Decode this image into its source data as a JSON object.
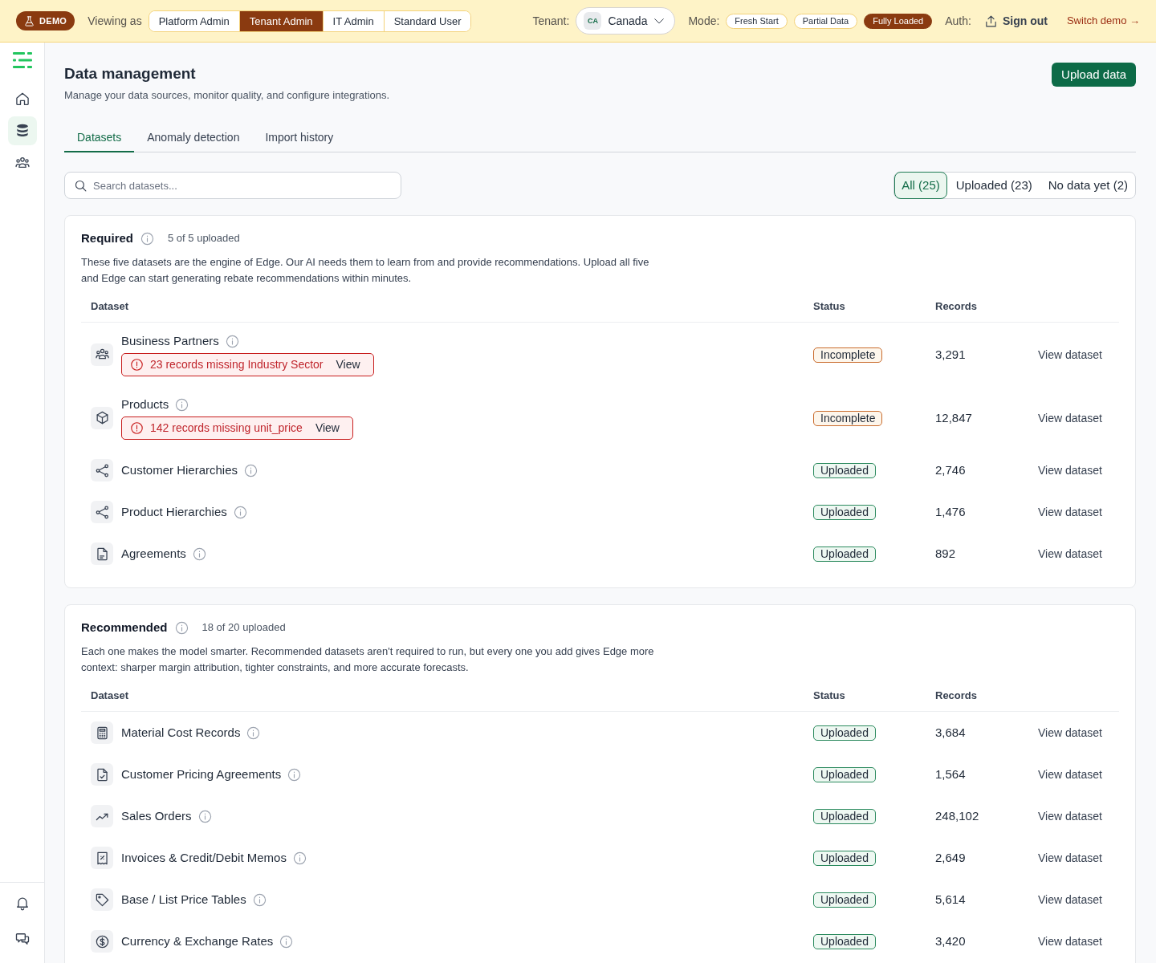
{
  "demo_bar": {
    "badge": "DEMO",
    "viewing_as_label": "Viewing as",
    "roles": [
      {
        "label": "Platform Admin",
        "selected": false
      },
      {
        "label": "Tenant Admin",
        "selected": true
      },
      {
        "label": "IT Admin",
        "selected": false
      },
      {
        "label": "Standard User",
        "selected": false
      }
    ],
    "tenant_label": "Tenant:",
    "tenant": {
      "code": "CA",
      "name": "Canada"
    },
    "mode_label": "Mode:",
    "modes": [
      {
        "label": "Fresh Start",
        "selected": false
      },
      {
        "label": "Partial Data",
        "selected": false
      },
      {
        "label": "Fully Loaded",
        "selected": true
      }
    ],
    "auth_label": "Auth:",
    "sign_out": "Sign out",
    "switch_demo": "Switch demo →"
  },
  "sidebar": {
    "items": [
      {
        "kind": "home",
        "selected": false
      },
      {
        "kind": "database",
        "selected": true
      },
      {
        "kind": "people",
        "selected": false
      }
    ],
    "bottom_items": [
      {
        "kind": "bell"
      },
      {
        "kind": "chat"
      }
    ]
  },
  "page": {
    "title": "Data management",
    "subtitle": "Manage your data sources, monitor quality, and configure integrations.",
    "upload_button": "Upload data"
  },
  "tabs": [
    {
      "label": "Datasets",
      "selected": true
    },
    {
      "label": "Anomaly detection",
      "selected": false
    },
    {
      "label": "Import history",
      "selected": false
    }
  ],
  "search": {
    "placeholder": "Search datasets..."
  },
  "filters": [
    {
      "label": "All (25)",
      "selected": true
    },
    {
      "label": "Uploaded (23)",
      "selected": false
    },
    {
      "label": "No data yet (2)",
      "selected": false
    }
  ],
  "sections": [
    {
      "title": "Required",
      "progress": "5 of 5 uploaded",
      "description": "These five datasets are the engine of Edge. Our AI needs them to learn from and provide recommendations. Upload all five and Edge can start generating rebate recommendations within minutes.",
      "columns": [
        "Dataset",
        "Status",
        "Records"
      ],
      "rows": [
        {
          "kind": "people",
          "name": "Business Partners",
          "alert": {
            "text": "23 records missing Industry Sector",
            "action": "View"
          },
          "status": {
            "kind": "incomplete",
            "label": "Incomplete"
          },
          "records": "3,291",
          "action": "View dataset"
        },
        {
          "kind": "cube",
          "name": "Products",
          "alert": {
            "text": "142 records missing unit_price",
            "action": "View"
          },
          "status": {
            "kind": "incomplete",
            "label": "Incomplete"
          },
          "records": "12,847",
          "action": "View dataset"
        },
        {
          "kind": "share",
          "name": "Customer Hierarchies",
          "status": {
            "kind": "uploaded",
            "label": "Uploaded"
          },
          "records": "2,746",
          "action": "View dataset"
        },
        {
          "kind": "share",
          "name": "Product Hierarchies",
          "status": {
            "kind": "uploaded",
            "label": "Uploaded"
          },
          "records": "1,476",
          "action": "View dataset"
        },
        {
          "kind": "document",
          "name": "Agreements",
          "status": {
            "kind": "uploaded",
            "label": "Uploaded"
          },
          "records": "892",
          "action": "View dataset"
        }
      ]
    },
    {
      "title": "Recommended",
      "progress": "18 of 20 uploaded",
      "description": "Each one makes the model smarter. Recommended datasets aren't required to run, but every one you add gives Edge more context: sharper margin attribution, tighter constraints, and more accurate forecasts.",
      "columns": [
        "Dataset",
        "Status",
        "Records"
      ],
      "rows": [
        {
          "kind": "calculator",
          "name": "Material Cost Records",
          "status": {
            "kind": "uploaded",
            "label": "Uploaded"
          },
          "records": "3,684",
          "action": "View dataset"
        },
        {
          "kind": "document-check",
          "name": "Customer Pricing Agreements",
          "status": {
            "kind": "uploaded",
            "label": "Uploaded"
          },
          "records": "1,564",
          "action": "View dataset"
        },
        {
          "kind": "trend",
          "name": "Sales Orders",
          "status": {
            "kind": "uploaded",
            "label": "Uploaded"
          },
          "records": "248,102",
          "action": "View dataset"
        },
        {
          "kind": "receipt",
          "name": "Invoices & Credit/Debit Memos",
          "status": {
            "kind": "uploaded",
            "label": "Uploaded"
          },
          "records": "2,649",
          "action": "View dataset"
        },
        {
          "kind": "tag",
          "name": "Base / List Price Tables",
          "status": {
            "kind": "uploaded",
            "label": "Uploaded"
          },
          "records": "5,614",
          "action": "View dataset"
        },
        {
          "kind": "dollar",
          "name": "Currency & Exchange Rates",
          "status": {
            "kind": "uploaded",
            "label": "Uploaded"
          },
          "records": "3,420",
          "action": "View dataset"
        }
      ]
    }
  ]
}
